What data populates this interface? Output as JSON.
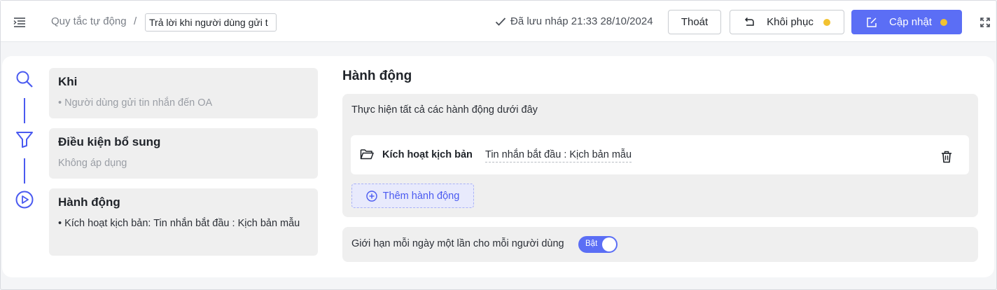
{
  "header": {
    "breadcrumb_parent": "Quy tắc tự động",
    "breadcrumb_separator": "/",
    "rule_name": "Trả lời khi người dùng gửi t",
    "saved_status": "Đã lưu nháp 21:33 28/10/2024",
    "exit_label": "Thoát",
    "restore_label": "Khôi phục",
    "update_label": "Cập nhật",
    "pending_dot_color": "#f2c230",
    "accent_color": "#5b6ef5"
  },
  "steps": [
    {
      "icon": "search-icon",
      "title": "Khi",
      "desc": "• Người dùng gửi tin nhắn đến OA"
    },
    {
      "icon": "filter-icon",
      "title": "Điều kiện bổ sung",
      "desc": "Không áp dụng"
    },
    {
      "icon": "play-icon",
      "title": "Hành động",
      "desc": "• Kích hoạt kịch bản: Tin nhắn bắt đầu : Kịch bản mẫu"
    }
  ],
  "actions": {
    "title": "Hành động",
    "note": "Thực hiện tất cả các hành động dưới đây",
    "items": [
      {
        "icon": "folder-icon",
        "type": "Kích hoạt kịch bản",
        "value": "Tin nhắn bắt đầu : Kịch bản mẫu"
      }
    ],
    "add_label": "Thêm hành động"
  },
  "limit": {
    "label": "Giới hạn mỗi ngày một lần cho mỗi người dùng",
    "toggle_label": "Bật",
    "enabled": true
  }
}
